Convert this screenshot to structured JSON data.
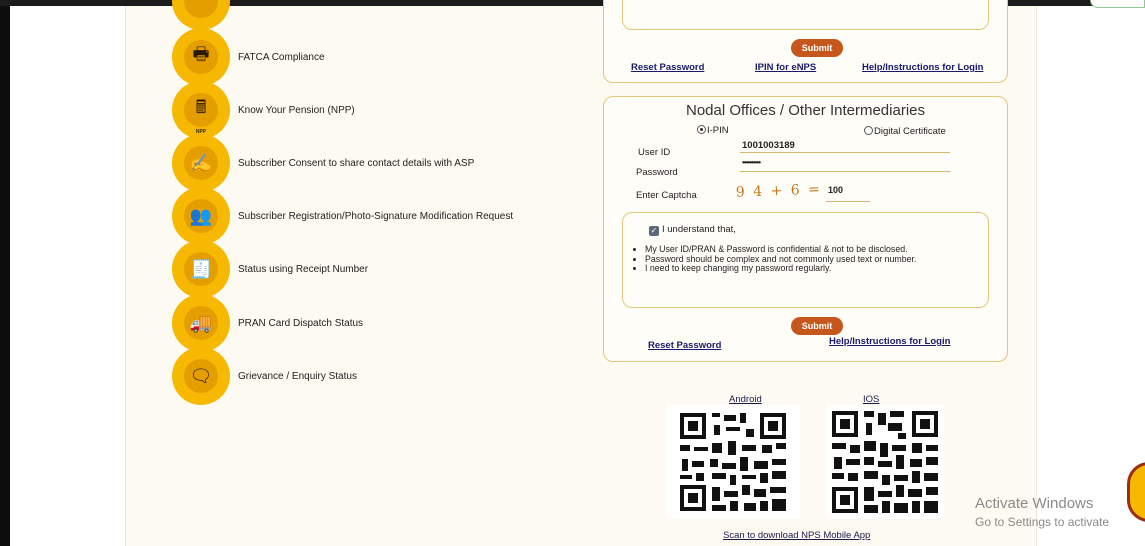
{
  "menu": [
    {
      "label": "FATCA Compliance",
      "icon": "printer-icon",
      "glyph": "🖶"
    },
    {
      "label": "Know Your Pension (NPP)",
      "icon": "calculator-icon",
      "glyph": "🖩",
      "badge": "NPP"
    },
    {
      "label": "Subscriber Consent to share contact details with ASP",
      "icon": "consent-form-icon",
      "glyph": "✍"
    },
    {
      "label": "Subscriber Registration/Photo-Signature Modification Request",
      "icon": "group-users-icon",
      "glyph": "👥"
    },
    {
      "label": "Status using Receipt Number",
      "icon": "receipt-icon",
      "glyph": "🧾"
    },
    {
      "label": "PRAN Card Dispatch Status",
      "icon": "delivery-truck-icon",
      "glyph": "🚚"
    },
    {
      "label": "Grievance / Enquiry Status",
      "icon": "support-person-icon",
      "glyph": "🗨"
    }
  ],
  "top_panel": {
    "submit": "Submit",
    "reset": "Reset Password",
    "ipin": "IPIN for eNPS",
    "help": "Help/Instructions for Login"
  },
  "nodal": {
    "title": "Nodal Offices / Other Intermediaries",
    "radio_ipin": "I-PIN",
    "radio_dc": "Digital Certificate",
    "userid_label": "User ID",
    "userid_value": "1001003189",
    "password_label": "Password",
    "password_value": "••••••••••",
    "captcha_label": "Enter Captcha",
    "captcha_text": "9 4 + 6 =",
    "captcha_value": "100",
    "understand": "I understand that,",
    "bullets": [
      "My User ID/PRAN & Password is confidential & not to be disclosed.",
      "Password should be complex and not commonly used text or number.",
      "I need to keep changing my password regularly."
    ],
    "submit": "Submit",
    "reset": "Reset Password",
    "help": "Help/Instructions for Login"
  },
  "apps": {
    "android": "Android",
    "ios": "IOS",
    "scan": "Scan to download NPS Mobile App"
  },
  "watermark": {
    "line1": "Activate Windows",
    "line2": "Go to Settings to activate"
  }
}
